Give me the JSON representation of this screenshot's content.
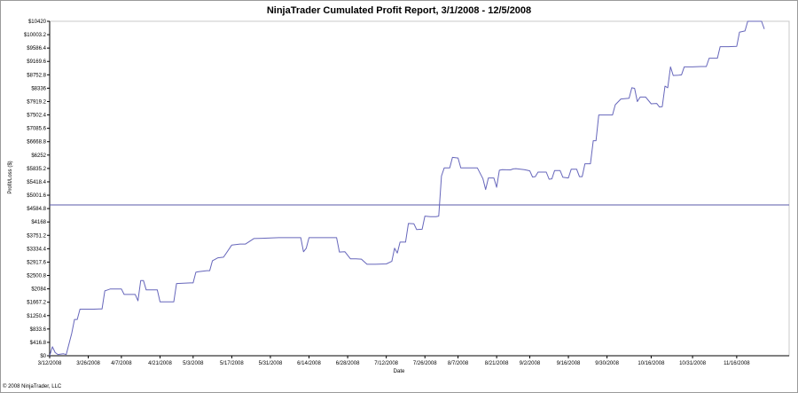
{
  "chart_data": {
    "type": "line",
    "title": "NinjaTrader Cumulated Profit Report, 3/1/2008 - 12/5/2008",
    "xlabel": "Date",
    "ylabel": "Profit/Loss ($)",
    "ylim": [
      0,
      10420
    ],
    "yticks": [
      0,
      416.8,
      833.6,
      1250.4,
      1667.2,
      2084,
      2500.8,
      2917.6,
      3334.4,
      3751.2,
      4168,
      4584.8,
      5001.6,
      5418.4,
      5835.2,
      6252,
      6668.8,
      7085.6,
      7502.4,
      7919.2,
      8336,
      8752.8,
      9169.6,
      9586.4,
      10003.2,
      10420
    ],
    "ytick_labels": [
      "$0",
      "$416.8",
      "$833.6",
      "$1250.4",
      "$1667.2",
      "$2084",
      "$2500.8",
      "$2917.6",
      "$3334.4",
      "$3751.2",
      "$4168",
      "$4584.8",
      "$5001.6",
      "$5418.4",
      "$5835.2",
      "$6252",
      "$6668.8",
      "$7085.6",
      "$7502.4",
      "$7919.2",
      "$8336",
      "$8752.8",
      "$9169.6",
      "$9586.4",
      "$10003.2",
      "$10420"
    ],
    "xlim": [
      "2008-03-12",
      "2008-12-05"
    ],
    "xticks": [
      "2008-03-12",
      "2008-03-26",
      "2008-04-07",
      "2008-04-21",
      "2008-05-03",
      "2008-05-17",
      "2008-05-31",
      "2008-06-14",
      "2008-06-28",
      "2008-07-12",
      "2008-07-26",
      "2008-08-07",
      "2008-08-21",
      "2008-09-02",
      "2008-09-16",
      "2008-09-30",
      "2008-10-16",
      "2008-10-31",
      "2008-11-16"
    ],
    "xtick_labels": [
      "3/12/2008",
      "3/26/2008",
      "4/7/2008",
      "4/21/2008",
      "5/3/2008",
      "5/17/2008",
      "5/31/2008",
      "6/14/2008",
      "6/28/2008",
      "7/12/2008",
      "7/26/2008",
      "8/7/2008",
      "8/21/2008",
      "9/2/2008",
      "9/16/2008",
      "9/30/2008",
      "10/16/2008",
      "10/31/2008",
      "11/16/2008"
    ],
    "grid": false,
    "horizontal_line": {
      "y": 4700
    },
    "series": [
      {
        "color": "#6666bb",
        "points": [
          [
            "2008-03-12",
            0
          ],
          [
            "2008-03-13",
            280
          ],
          [
            "2008-03-14",
            100
          ],
          [
            "2008-03-15",
            40
          ],
          [
            "2008-03-17",
            60
          ],
          [
            "2008-03-18",
            40
          ],
          [
            "2008-03-20",
            700
          ],
          [
            "2008-03-21",
            1130
          ],
          [
            "2008-03-22",
            1130
          ],
          [
            "2008-03-23",
            1450
          ],
          [
            "2008-03-26",
            1450
          ],
          [
            "2008-03-27",
            1450
          ],
          [
            "2008-03-28",
            1450
          ],
          [
            "2008-03-30",
            1460
          ],
          [
            "2008-03-31",
            1460
          ],
          [
            "2008-04-01",
            2020
          ],
          [
            "2008-04-02",
            2050
          ],
          [
            "2008-04-03",
            2080
          ],
          [
            "2008-04-06",
            2080
          ],
          [
            "2008-04-07",
            2080
          ],
          [
            "2008-04-08",
            1910
          ],
          [
            "2008-04-11",
            1910
          ],
          [
            "2008-04-12",
            1910
          ],
          [
            "2008-04-13",
            1710
          ],
          [
            "2008-04-14",
            2340
          ],
          [
            "2008-04-15",
            2340
          ],
          [
            "2008-04-16",
            2050
          ],
          [
            "2008-04-17",
            2050
          ],
          [
            "2008-04-20",
            2050
          ],
          [
            "2008-04-21",
            1680
          ],
          [
            "2008-04-24",
            1680
          ],
          [
            "2008-04-26",
            1680
          ],
          [
            "2008-04-27",
            2250
          ],
          [
            "2008-05-02",
            2270
          ],
          [
            "2008-05-03",
            2270
          ],
          [
            "2008-05-04",
            2600
          ],
          [
            "2008-05-05",
            2620
          ],
          [
            "2008-05-08",
            2650
          ],
          [
            "2008-05-09",
            2650
          ],
          [
            "2008-05-10",
            2960
          ],
          [
            "2008-05-12",
            3050
          ],
          [
            "2008-05-14",
            3070
          ],
          [
            "2008-05-17",
            3450
          ],
          [
            "2008-05-20",
            3480
          ],
          [
            "2008-05-22",
            3480
          ],
          [
            "2008-05-25",
            3650
          ],
          [
            "2008-05-28",
            3660
          ],
          [
            "2008-05-31",
            3670
          ],
          [
            "2008-06-03",
            3680
          ],
          [
            "2008-06-06",
            3680
          ],
          [
            "2008-06-09",
            3680
          ],
          [
            "2008-06-11",
            3680
          ],
          [
            "2008-06-12",
            3240
          ],
          [
            "2008-06-13",
            3350
          ],
          [
            "2008-06-14",
            3680
          ],
          [
            "2008-06-18",
            3680
          ],
          [
            "2008-06-22",
            3680
          ],
          [
            "2008-06-24",
            3680
          ],
          [
            "2008-06-25",
            3230
          ],
          [
            "2008-06-27",
            3240
          ],
          [
            "2008-06-29",
            3020
          ],
          [
            "2008-07-01",
            3020
          ],
          [
            "2008-07-03",
            3010
          ],
          [
            "2008-07-05",
            2850
          ],
          [
            "2008-07-08",
            2850
          ],
          [
            "2008-07-12",
            2860
          ],
          [
            "2008-07-14",
            2940
          ],
          [
            "2008-07-15",
            3350
          ],
          [
            "2008-07-16",
            3200
          ],
          [
            "2008-07-17",
            3540
          ],
          [
            "2008-07-19",
            3540
          ],
          [
            "2008-07-20",
            4120
          ],
          [
            "2008-07-22",
            4110
          ],
          [
            "2008-07-23",
            3930
          ],
          [
            "2008-07-25",
            3940
          ],
          [
            "2008-07-26",
            4350
          ],
          [
            "2008-07-28",
            4330
          ],
          [
            "2008-07-30",
            4330
          ],
          [
            "2008-07-31",
            4350
          ],
          [
            "2008-08-01",
            5600
          ],
          [
            "2008-08-02",
            5850
          ],
          [
            "2008-08-04",
            5850
          ],
          [
            "2008-08-05",
            6180
          ],
          [
            "2008-08-07",
            6160
          ],
          [
            "2008-08-08",
            5850
          ],
          [
            "2008-08-10",
            5850
          ],
          [
            "2008-08-12",
            5850
          ],
          [
            "2008-08-14",
            5850
          ],
          [
            "2008-08-16",
            5520
          ],
          [
            "2008-08-17",
            5180
          ],
          [
            "2008-08-18",
            5540
          ],
          [
            "2008-08-20",
            5540
          ],
          [
            "2008-08-21",
            5250
          ],
          [
            "2008-08-22",
            5780
          ],
          [
            "2008-08-23",
            5800
          ],
          [
            "2008-08-26",
            5790
          ],
          [
            "2008-08-27",
            5820
          ],
          [
            "2008-08-28",
            5830
          ],
          [
            "2008-08-31",
            5800
          ],
          [
            "2008-09-01",
            5780
          ],
          [
            "2008-09-02",
            5760
          ],
          [
            "2008-09-03",
            5570
          ],
          [
            "2008-09-04",
            5580
          ],
          [
            "2008-09-05",
            5720
          ],
          [
            "2008-09-08",
            5720
          ],
          [
            "2008-09-09",
            5500
          ],
          [
            "2008-09-10",
            5510
          ],
          [
            "2008-09-11",
            5770
          ],
          [
            "2008-09-13",
            5770
          ],
          [
            "2008-09-14",
            5560
          ],
          [
            "2008-09-16",
            5540
          ],
          [
            "2008-09-17",
            5810
          ],
          [
            "2008-09-19",
            5810
          ],
          [
            "2008-09-20",
            5580
          ],
          [
            "2008-09-21",
            5580
          ],
          [
            "2008-09-22",
            5980
          ],
          [
            "2008-09-24",
            5980
          ],
          [
            "2008-09-25",
            6700
          ],
          [
            "2008-09-26",
            6700
          ],
          [
            "2008-09-27",
            7500
          ],
          [
            "2008-09-30",
            7500
          ],
          [
            "2008-10-02",
            7500
          ],
          [
            "2008-10-03",
            7820
          ],
          [
            "2008-10-05",
            8000
          ],
          [
            "2008-10-08",
            8020
          ],
          [
            "2008-10-09",
            8350
          ],
          [
            "2008-10-10",
            8330
          ],
          [
            "2008-10-11",
            7920
          ],
          [
            "2008-10-12",
            8060
          ],
          [
            "2008-10-14",
            8060
          ],
          [
            "2008-10-16",
            7850
          ],
          [
            "2008-10-18",
            7860
          ],
          [
            "2008-10-19",
            7750
          ],
          [
            "2008-10-20",
            7760
          ],
          [
            "2008-10-21",
            8400
          ],
          [
            "2008-10-22",
            8350
          ],
          [
            "2008-10-23",
            9000
          ],
          [
            "2008-10-24",
            8730
          ],
          [
            "2008-10-26",
            8740
          ],
          [
            "2008-10-27",
            8750
          ],
          [
            "2008-10-28",
            9000
          ],
          [
            "2008-10-31",
            9000
          ],
          [
            "2008-11-03",
            9010
          ],
          [
            "2008-11-05",
            9010
          ],
          [
            "2008-11-06",
            9270
          ],
          [
            "2008-11-09",
            9270
          ],
          [
            "2008-11-10",
            9630
          ],
          [
            "2008-11-13",
            9630
          ],
          [
            "2008-11-16",
            9640
          ],
          [
            "2008-11-17",
            10080
          ],
          [
            "2008-11-19",
            10120
          ],
          [
            "2008-11-20",
            10420
          ],
          [
            "2008-11-22",
            10420
          ],
          [
            "2008-11-25",
            10420
          ],
          [
            "2008-11-26",
            10180
          ]
        ]
      }
    ]
  },
  "footer": {
    "copyright": "© 2008 NinjaTrader, LLC"
  }
}
